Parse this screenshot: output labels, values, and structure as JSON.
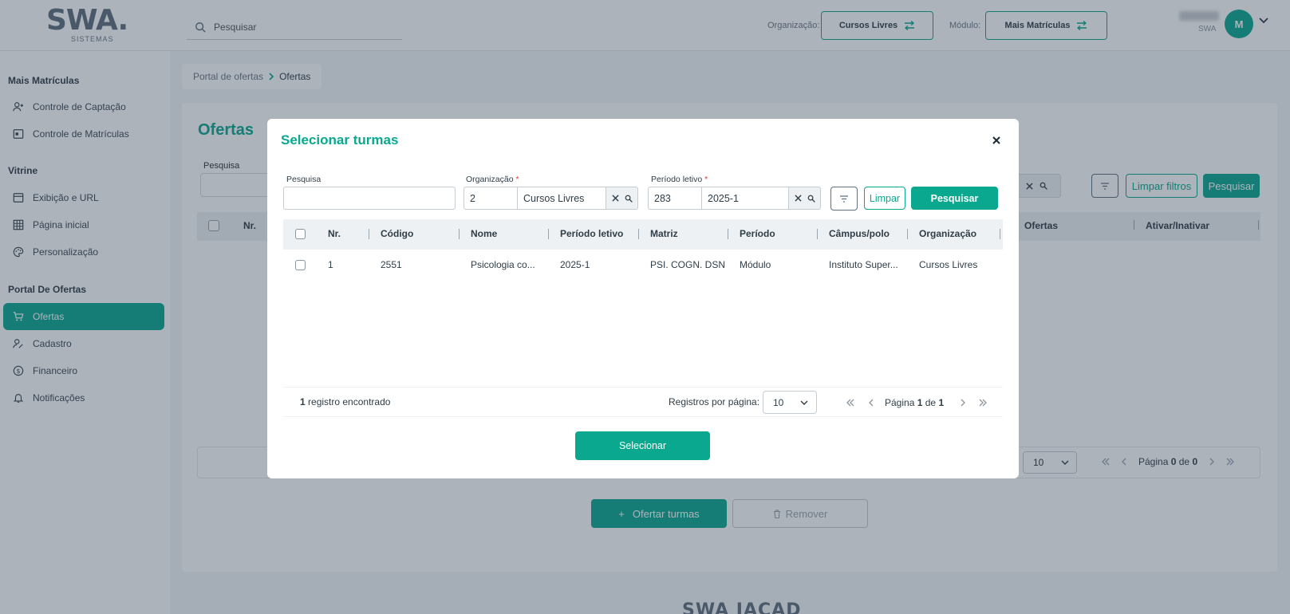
{
  "header": {
    "logo_text": "SWA.",
    "logo_sub": "SISTEMAS",
    "search_placeholder": "Pesquisar",
    "org_label": "Organização:",
    "org_value": "Cursos Livres",
    "module_label": "Módulo:",
    "module_value": "Mais Matrículas",
    "user_sub": "SWA",
    "avatar_initial": "M"
  },
  "sidebar": {
    "sections": [
      {
        "title": "Mais Matrículas",
        "items": [
          {
            "label": "Controle de Captação",
            "icon": "user-plus-icon"
          },
          {
            "label": "Controle de Matrículas",
            "icon": "id-card-icon"
          }
        ]
      },
      {
        "title": "Vitrine",
        "items": [
          {
            "label": "Exibição e URL",
            "icon": "storefront-icon"
          },
          {
            "label": "Página inicial",
            "icon": "grid-icon"
          },
          {
            "label": "Personalização",
            "icon": "palette-icon"
          }
        ]
      },
      {
        "title": "Portal De Ofertas",
        "items": [
          {
            "label": "Ofertas",
            "icon": "cart-icon",
            "active": true
          },
          {
            "label": "Cadastro",
            "icon": "user-edit-icon"
          },
          {
            "label": "Financeiro",
            "icon": "dollar-icon"
          },
          {
            "label": "Notificações",
            "icon": "bell-icon"
          }
        ]
      }
    ]
  },
  "breadcrumb": {
    "parent": "Portal de ofertas",
    "current": "Ofertas"
  },
  "page": {
    "title": "Ofertas",
    "search_label": "Pesquisa",
    "clear_filters": "Limpar filtros",
    "search_button": "Pesquisar",
    "columns": {
      "nr": "Nr.",
      "ofertas": "Ofertas",
      "ativar": "Ativar/Inativar"
    },
    "per_page": "10",
    "pager_prefix": "Página",
    "pager_current": "0",
    "pager_of": "de",
    "pager_total": "0",
    "add_button": "Ofertar turmas",
    "remove_button": "Remover",
    "footer_logo": "SWA JACAD"
  },
  "modal": {
    "title": "Selecionar turmas",
    "filters": {
      "search_label": "Pesquisa",
      "search_value": "",
      "org_label": "Organização",
      "org_code": "2",
      "org_name": "Cursos Livres",
      "period_label": "Período letivo",
      "period_code": "283",
      "period_name": "2025-1",
      "required_mark": "*",
      "clear_button": "Limpar",
      "search_button": "Pesquisar"
    },
    "columns": [
      "Nr.",
      "Código",
      "Nome",
      "Período letivo",
      "Matriz",
      "Período",
      "Câmpus/polo",
      "Organização"
    ],
    "rows": [
      [
        "1",
        "2551",
        "Psicologia co...",
        "2025-1",
        "PSI. COGN. DSN",
        "Módulo",
        "Instituto Super...",
        "Cursos Livres"
      ]
    ],
    "footer": {
      "count": "1",
      "count_suffix": "registro encontrado",
      "per_page_label": "Registros por página:",
      "per_page_value": "10",
      "pager_prefix": "Página",
      "pager_current": "1",
      "pager_of": "de",
      "pager_total": "1"
    },
    "select_button": "Selecionar"
  },
  "colors": {
    "accent": "#0aa88f",
    "text": "#2f3d47",
    "required": "#e03a3a"
  }
}
